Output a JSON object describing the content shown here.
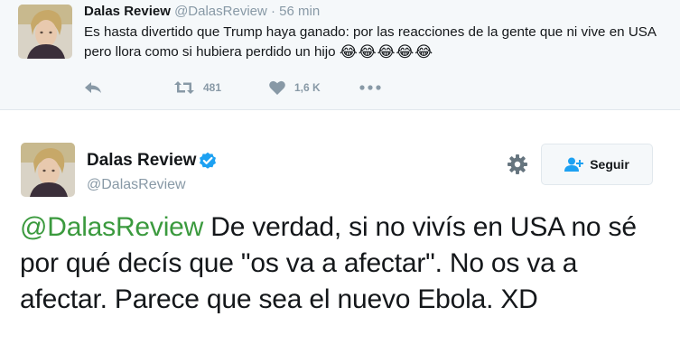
{
  "parent_tweet": {
    "name": "Dalas Review",
    "handle": "@DalasReview",
    "separator": "·",
    "time": "56 min",
    "text": "Es hasta divertido que Trump haya ganado: por las reacciones de la gente que ni vive en USA pero llora como si hubiera perdido un hijo",
    "emoji": "😂😂😂😂😂",
    "retweet_count": "481",
    "like_count": "1,6 K"
  },
  "main_tweet": {
    "name": "Dalas Review",
    "handle": "@DalasReview",
    "follow_label": "Seguir",
    "mention": "@DalasReview",
    "text": " De verdad, si no vivís en USA no sé por qué decís que \"os va a afectar\". No os va a afectar. Parece que sea el nuevo Ebola. XD"
  },
  "colors": {
    "mention": "#3b9a3e",
    "verified": "#1da1f2",
    "follow_icon": "#1da1f2",
    "secondary_text": "#8899a6"
  }
}
